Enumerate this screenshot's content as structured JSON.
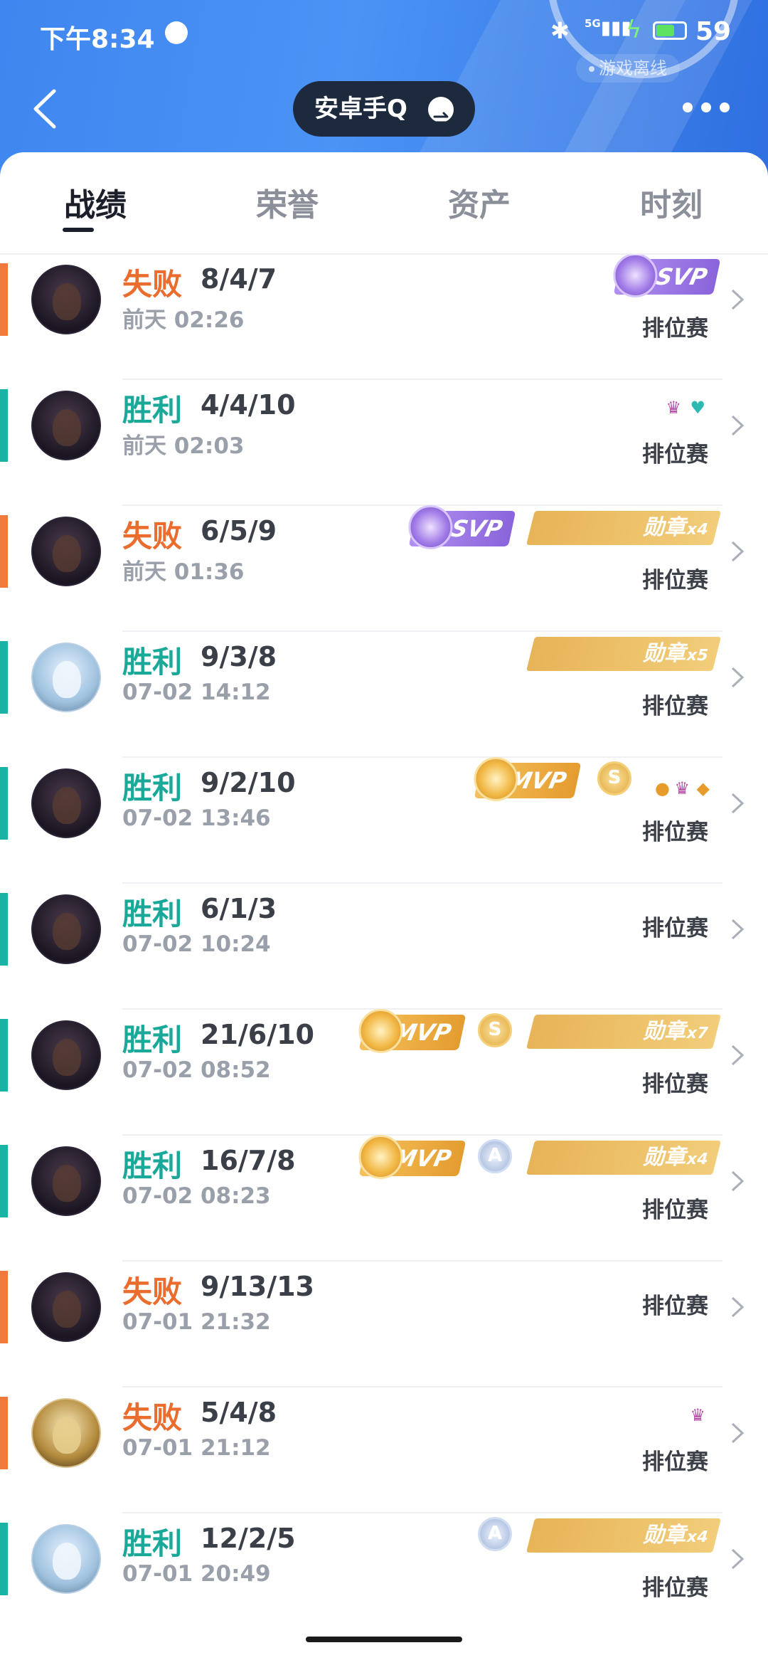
{
  "status": {
    "time": "下午8:34",
    "signal": "5G",
    "battery": "59",
    "battery_level": 0.59
  },
  "header": {
    "offline_label": "游戏离线",
    "account_name": "安卓手Q",
    "icons": {
      "back": "chevron-left-icon",
      "swap": "swap-icon",
      "more": "more-dots-icon"
    }
  },
  "tabs": [
    {
      "label": "战绩",
      "active": true
    },
    {
      "label": "荣誉",
      "active": false
    },
    {
      "label": "资产",
      "active": false
    },
    {
      "label": "时刻",
      "active": false
    }
  ],
  "colors": {
    "win": "#18b3a3",
    "loss": "#f0793c",
    "header": "#3f86f0"
  },
  "matches": [
    {
      "result": "失败",
      "kda": "8/4/7",
      "time": "前天 02:26",
      "mode": "排位赛",
      "type": "loss",
      "avatar": "dark",
      "badges": [
        "SVP"
      ]
    },
    {
      "result": "胜利",
      "kda": "4/4/10",
      "time": "前天 02:03",
      "mode": "排位赛",
      "type": "win",
      "avatar": "dark",
      "badges": [
        "small-icons"
      ]
    },
    {
      "result": "失败",
      "kda": "6/5/9",
      "time": "前天 01:36",
      "mode": "排位赛",
      "type": "loss",
      "avatar": "dark",
      "badges": [
        "SVP",
        "勋章x4"
      ]
    },
    {
      "result": "胜利",
      "kda": "9/3/8",
      "time": "07-02 14:12",
      "mode": "排位赛",
      "type": "win",
      "avatar": "light",
      "badges": [
        "勋章x5"
      ]
    },
    {
      "result": "胜利",
      "kda": "9/2/10",
      "time": "07-02 13:46",
      "mode": "排位赛",
      "type": "win",
      "avatar": "dark",
      "badges": [
        "MVP",
        "S",
        "small-icons"
      ]
    },
    {
      "result": "胜利",
      "kda": "6/1/3",
      "time": "07-02 10:24",
      "mode": "排位赛",
      "type": "win",
      "avatar": "dark",
      "badges": []
    },
    {
      "result": "胜利",
      "kda": "21/6/10",
      "time": "07-02 08:52",
      "mode": "排位赛",
      "type": "win",
      "avatar": "dark",
      "badges": [
        "MVP",
        "S",
        "勋章x7"
      ]
    },
    {
      "result": "胜利",
      "kda": "16/7/8",
      "time": "07-02 08:23",
      "mode": "排位赛",
      "type": "win",
      "avatar": "dark",
      "badges": [
        "MVP",
        "A",
        "勋章x4"
      ]
    },
    {
      "result": "失败",
      "kda": "9/13/13",
      "time": "07-01 21:32",
      "mode": "排位赛",
      "type": "loss",
      "avatar": "dark",
      "badges": []
    },
    {
      "result": "失败",
      "kda": "5/4/8",
      "time": "07-01 21:12",
      "mode": "排位赛",
      "type": "loss",
      "avatar": "gold",
      "badges": [
        "small-icon"
      ]
    },
    {
      "result": "胜利",
      "kda": "12/2/5",
      "time": "07-01 20:49",
      "mode": "排位赛",
      "type": "win",
      "avatar": "light",
      "badges": [
        "A",
        "勋章x4"
      ]
    }
  ],
  "badge_text": {
    "mvp": "MVP",
    "svp": "SVP",
    "medal": "勋章",
    "coin_s": "S",
    "coin_a": "A",
    "x4": "x4",
    "x5": "x5",
    "x7": "x7"
  }
}
